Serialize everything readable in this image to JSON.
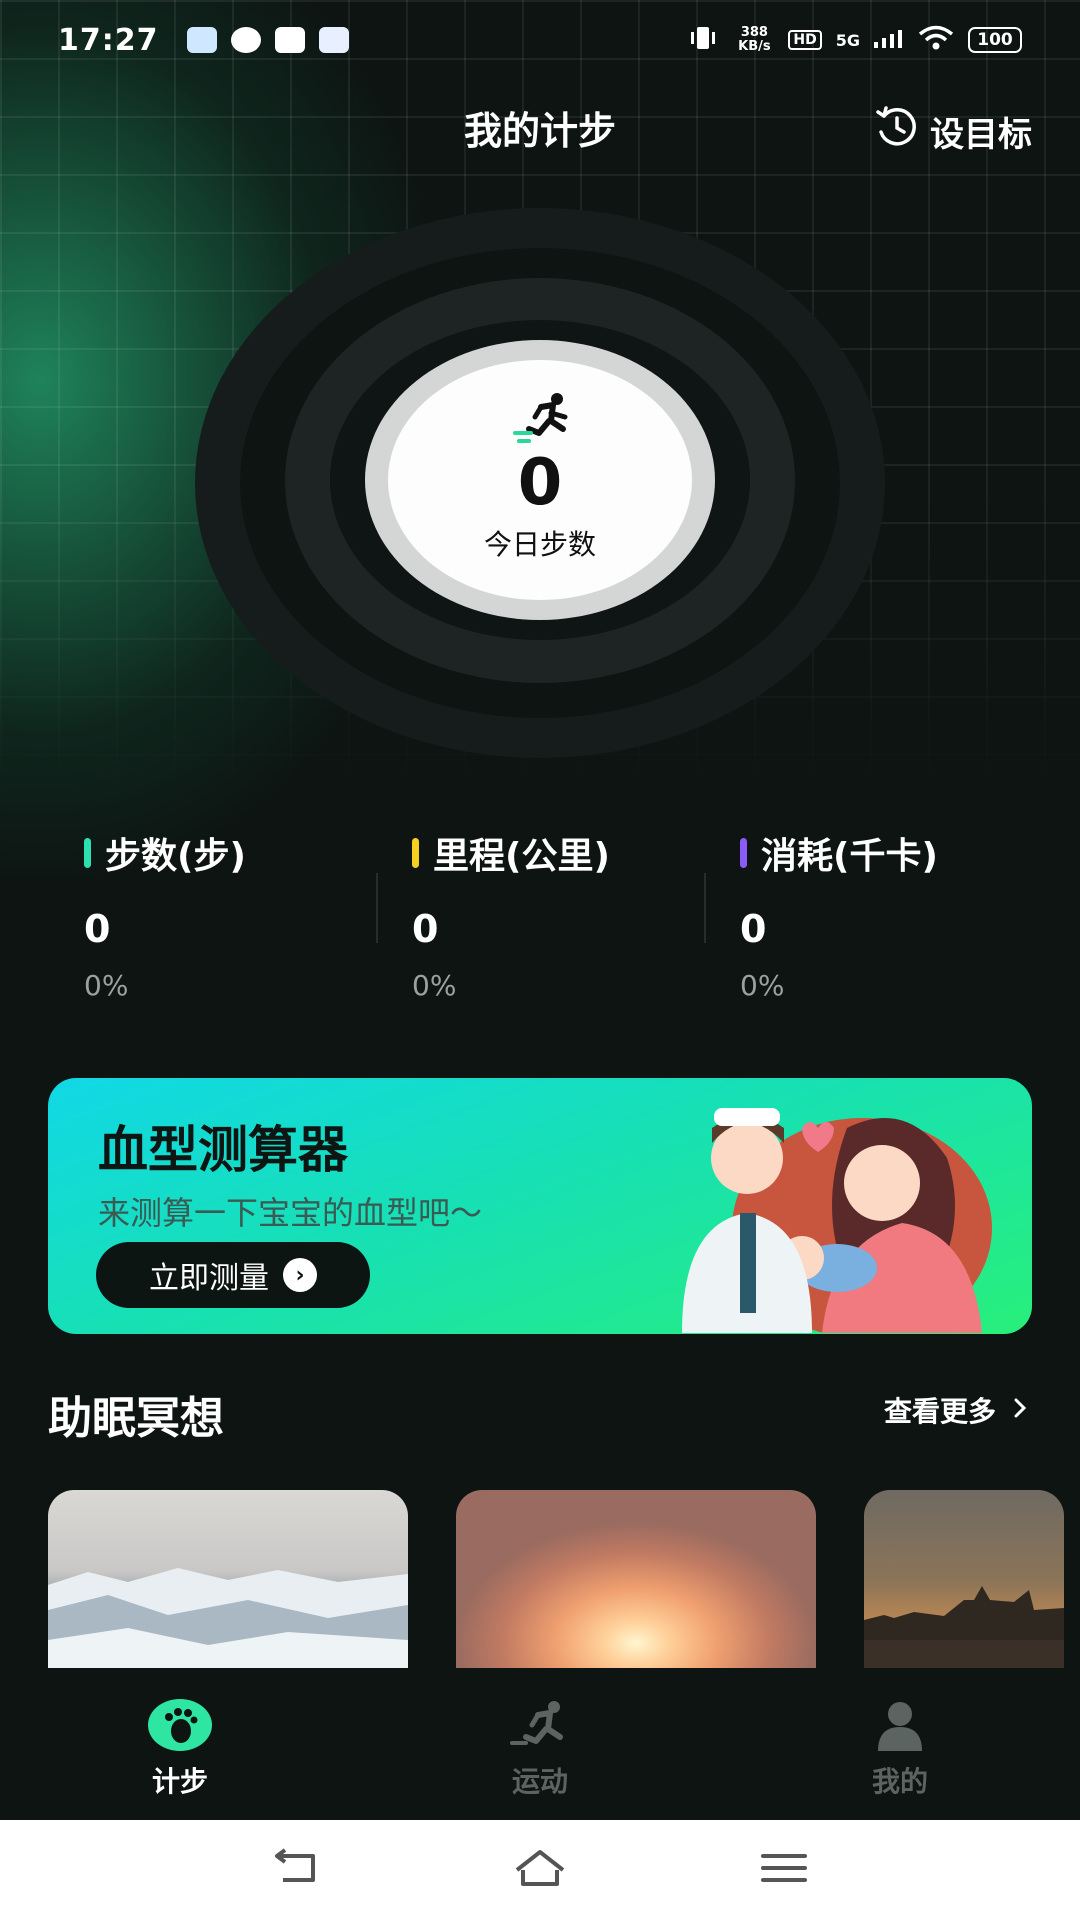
{
  "status_bar": {
    "time": "17:27",
    "net_speed": "388 KB/s",
    "hd": "HD",
    "signal": "5G",
    "battery": "100"
  },
  "header": {
    "title": "我的计步",
    "goal_label": "设目标"
  },
  "center": {
    "steps": "0",
    "label": "今日步数"
  },
  "stats": [
    {
      "label": "步数(步)",
      "value": "0",
      "percent": "0%",
      "color": "#2de0b0"
    },
    {
      "label": "里程(公里)",
      "value": "0",
      "percent": "0%",
      "color": "#f5d020"
    },
    {
      "label": "消耗(千卡)",
      "value": "0",
      "percent": "0%",
      "color": "#8a5cf5"
    }
  ],
  "banner": {
    "title": "血型测算器",
    "subtitle": "来测算一下宝宝的血型吧～",
    "button": "立即测量"
  },
  "section": {
    "title": "助眠冥想",
    "more": "查看更多"
  },
  "nav": [
    {
      "label": "计步",
      "icon": "footprint-icon",
      "active": true
    },
    {
      "label": "运动",
      "icon": "running-icon",
      "active": false
    },
    {
      "label": "我的",
      "icon": "person-icon",
      "active": false
    }
  ]
}
